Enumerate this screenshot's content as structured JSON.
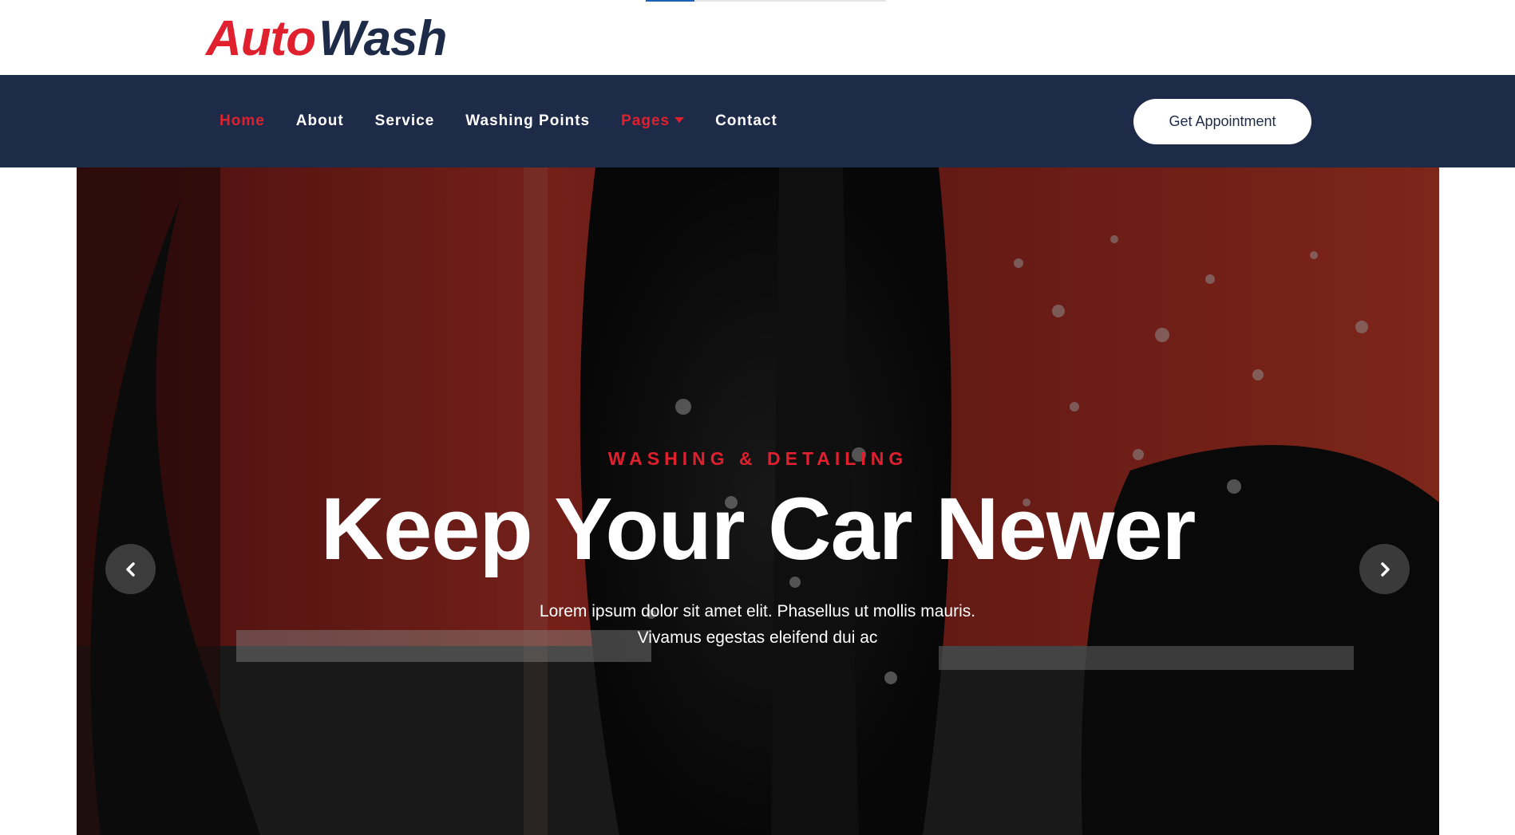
{
  "header": {
    "logo_part1": "Auto",
    "logo_part2": "Wash"
  },
  "nav": {
    "items": [
      {
        "label": "Home",
        "active": true
      },
      {
        "label": "About"
      },
      {
        "label": "Service"
      },
      {
        "label": "Washing Points"
      },
      {
        "label": "Pages",
        "dropdown": true
      },
      {
        "label": "Contact"
      }
    ],
    "cta_label": "Get Appointment"
  },
  "hero": {
    "subtitle": "WASHING & DETAILING",
    "title": "Keep Your Car Newer",
    "text_line1": "Lorem ipsum dolor sit amet elit. Phasellus ut mollis mauris.",
    "text_line2": "Vivamus egestas eleifend dui ac",
    "prev_icon": "chevron-left-icon",
    "next_icon": "chevron-right-icon"
  },
  "colors": {
    "brand_red": "#e0202e",
    "brand_navy": "#1e2b48"
  }
}
